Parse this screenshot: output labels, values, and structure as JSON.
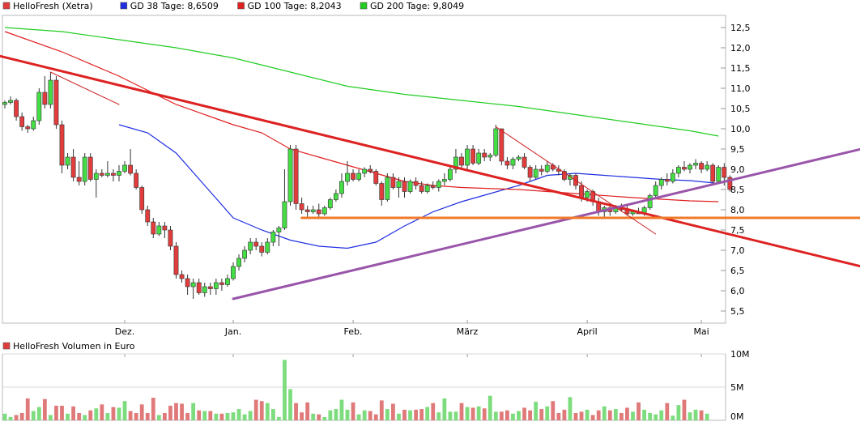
{
  "chart_data": [
    {
      "type": "candlestick",
      "legend": [
        {
          "label": "HelloFresh (Xetra)",
          "color": "#e03c3c"
        },
        {
          "label": "GD 38 Tage: 8,6509",
          "color": "#1f2fe0"
        },
        {
          "label": "GD 100 Tage: 8,2043",
          "color": "#e02020"
        },
        {
          "label": "GD 200 Tage: 9,8049",
          "color": "#22cc22"
        }
      ],
      "ylim": [
        5.2,
        12.8
      ],
      "y_ticks": [
        "5,5",
        "6,0",
        "6,5",
        "7,0",
        "7,5",
        "8,0",
        "8,5",
        "9,0",
        "9,5",
        "10,0",
        "10,5",
        "11,0",
        "11,5",
        "12,0",
        "12,5"
      ],
      "x_ticks": [
        {
          "label": "Dez.",
          "index": 21
        },
        {
          "label": "Jan.",
          "index": 40
        },
        {
          "label": "Feb.",
          "index": 61
        },
        {
          "label": "März",
          "index": 81
        },
        {
          "label": "April",
          "index": 102
        },
        {
          "label": "Mai",
          "index": 122
        }
      ],
      "ohlc": [
        [
          10.6,
          10.7,
          10.5,
          10.65
        ],
        [
          10.65,
          10.8,
          10.6,
          10.7
        ],
        [
          10.7,
          10.75,
          10.2,
          10.3
        ],
        [
          10.3,
          10.4,
          9.95,
          10.05
        ],
        [
          10.05,
          10.1,
          9.9,
          10.0
        ],
        [
          10.0,
          10.3,
          9.95,
          10.2
        ],
        [
          10.2,
          11.0,
          10.1,
          10.9
        ],
        [
          10.9,
          11.3,
          10.5,
          10.6
        ],
        [
          10.6,
          11.4,
          10.5,
          11.2
        ],
        [
          11.2,
          11.3,
          10.0,
          10.1
        ],
        [
          10.1,
          10.2,
          8.9,
          9.1
        ],
        [
          9.1,
          9.4,
          9.0,
          9.3
        ],
        [
          9.3,
          9.5,
          8.7,
          8.8
        ],
        [
          8.8,
          9.2,
          8.6,
          8.7
        ],
        [
          8.7,
          9.4,
          8.6,
          9.3
        ],
        [
          9.3,
          9.4,
          8.7,
          8.75
        ],
        [
          8.75,
          9.0,
          8.3,
          8.9
        ],
        [
          8.9,
          9.0,
          8.8,
          8.85
        ],
        [
          8.85,
          9.2,
          8.8,
          8.9
        ],
        [
          8.9,
          9.0,
          8.7,
          8.85
        ],
        [
          8.85,
          9.1,
          8.7,
          8.95
        ],
        [
          8.95,
          9.2,
          8.9,
          9.1
        ],
        [
          9.1,
          9.5,
          8.85,
          8.9
        ],
        [
          8.9,
          9.0,
          8.5,
          8.55
        ],
        [
          8.55,
          8.6,
          7.9,
          8.0
        ],
        [
          8.0,
          8.1,
          7.6,
          7.7
        ],
        [
          7.7,
          7.8,
          7.3,
          7.4
        ],
        [
          7.4,
          7.7,
          7.35,
          7.6
        ],
        [
          7.6,
          7.7,
          7.3,
          7.5
        ],
        [
          7.5,
          7.6,
          7.0,
          7.1
        ],
        [
          7.1,
          7.2,
          6.3,
          6.4
        ],
        [
          6.4,
          6.5,
          6.2,
          6.3
        ],
        [
          6.3,
          6.4,
          5.9,
          6.1
        ],
        [
          6.1,
          6.3,
          5.8,
          6.2
        ],
        [
          6.2,
          6.3,
          5.9,
          5.95
        ],
        [
          5.95,
          6.2,
          5.85,
          6.1
        ],
        [
          6.1,
          6.2,
          5.9,
          6.05
        ],
        [
          6.05,
          6.3,
          5.9,
          6.2
        ],
        [
          6.2,
          6.3,
          6.0,
          6.15
        ],
        [
          6.15,
          6.4,
          6.1,
          6.3
        ],
        [
          6.3,
          6.7,
          6.25,
          6.6
        ],
        [
          6.6,
          6.9,
          6.5,
          6.8
        ],
        [
          6.8,
          7.1,
          6.7,
          7.0
        ],
        [
          7.0,
          7.3,
          6.9,
          7.2
        ],
        [
          7.2,
          7.3,
          7.0,
          7.1
        ],
        [
          7.1,
          7.2,
          6.85,
          6.95
        ],
        [
          6.95,
          7.3,
          6.9,
          7.2
        ],
        [
          7.2,
          7.5,
          7.1,
          7.45
        ],
        [
          7.45,
          7.6,
          7.1,
          7.55
        ],
        [
          7.55,
          9.0,
          7.5,
          8.2
        ],
        [
          8.2,
          9.6,
          8.1,
          9.5
        ],
        [
          9.5,
          9.6,
          8.0,
          8.15
        ],
        [
          8.15,
          8.3,
          7.9,
          8.0
        ],
        [
          8.0,
          8.1,
          7.8,
          7.95
        ],
        [
          7.95,
          8.1,
          7.9,
          8.0
        ],
        [
          8.0,
          8.15,
          7.8,
          7.9
        ],
        [
          7.9,
          8.1,
          7.85,
          8.05
        ],
        [
          8.05,
          8.3,
          8.0,
          8.25
        ],
        [
          8.25,
          8.5,
          8.2,
          8.4
        ],
        [
          8.4,
          8.9,
          8.3,
          8.7
        ],
        [
          8.7,
          9.2,
          8.6,
          8.9
        ],
        [
          8.9,
          9.0,
          8.7,
          8.75
        ],
        [
          8.75,
          9.0,
          8.7,
          8.9
        ],
        [
          8.9,
          9.05,
          8.8,
          9.0
        ],
        [
          9.0,
          9.1,
          8.9,
          8.95
        ],
        [
          8.95,
          9.0,
          8.6,
          8.65
        ],
        [
          8.65,
          8.7,
          8.1,
          8.25
        ],
        [
          8.25,
          8.9,
          8.2,
          8.8
        ],
        [
          8.8,
          8.9,
          8.5,
          8.55
        ],
        [
          8.55,
          8.8,
          8.3,
          8.7
        ],
        [
          8.7,
          8.8,
          8.3,
          8.45
        ],
        [
          8.45,
          8.75,
          8.4,
          8.7
        ],
        [
          8.7,
          8.8,
          8.5,
          8.6
        ],
        [
          8.6,
          8.7,
          8.4,
          8.45
        ],
        [
          8.45,
          8.65,
          8.4,
          8.6
        ],
        [
          8.6,
          8.7,
          8.5,
          8.55
        ],
        [
          8.55,
          8.75,
          8.45,
          8.7
        ],
        [
          8.7,
          8.9,
          8.6,
          8.75
        ],
        [
          8.75,
          9.1,
          8.7,
          9.0
        ],
        [
          9.0,
          9.5,
          8.9,
          9.3
        ],
        [
          9.3,
          9.4,
          9.0,
          9.1
        ],
        [
          9.1,
          9.6,
          9.0,
          9.5
        ],
        [
          9.5,
          9.6,
          9.1,
          9.15
        ],
        [
          9.15,
          9.5,
          9.1,
          9.4
        ],
        [
          9.4,
          9.5,
          9.2,
          9.3
        ],
        [
          9.3,
          9.4,
          9.2,
          9.35
        ],
        [
          9.35,
          10.1,
          9.3,
          10.0
        ],
        [
          10.0,
          10.0,
          9.1,
          9.2
        ],
        [
          9.2,
          9.3,
          9.0,
          9.1
        ],
        [
          9.1,
          9.3,
          9.0,
          9.25
        ],
        [
          9.25,
          9.35,
          9.2,
          9.3
        ],
        [
          9.3,
          9.4,
          9.0,
          9.05
        ],
        [
          9.05,
          9.1,
          8.7,
          8.8
        ],
        [
          8.8,
          9.1,
          8.75,
          9.0
        ],
        [
          9.0,
          9.1,
          8.85,
          8.95
        ],
        [
          8.95,
          9.2,
          8.9,
          9.1
        ],
        [
          9.1,
          9.15,
          8.95,
          9.0
        ],
        [
          9.0,
          9.1,
          8.85,
          8.95
        ],
        [
          8.95,
          9.0,
          8.7,
          8.75
        ],
        [
          8.75,
          8.9,
          8.6,
          8.85
        ],
        [
          8.85,
          8.9,
          8.5,
          8.6
        ],
        [
          8.6,
          8.7,
          8.2,
          8.3
        ],
        [
          8.3,
          8.5,
          8.2,
          8.45
        ],
        [
          8.45,
          8.5,
          8.1,
          8.2
        ],
        [
          8.2,
          8.3,
          7.85,
          7.95
        ],
        [
          7.95,
          8.1,
          7.8,
          8.05
        ],
        [
          8.05,
          8.15,
          7.85,
          7.95
        ],
        [
          7.95,
          8.1,
          7.9,
          8.05
        ],
        [
          8.05,
          8.15,
          7.95,
          8.0
        ],
        [
          8.0,
          8.1,
          7.85,
          7.9
        ],
        [
          7.9,
          8.0,
          7.85,
          7.95
        ],
        [
          7.95,
          8.05,
          7.9,
          7.9
        ],
        [
          7.9,
          8.1,
          7.85,
          8.05
        ],
        [
          8.05,
          8.4,
          8.0,
          8.35
        ],
        [
          8.35,
          8.7,
          8.3,
          8.6
        ],
        [
          8.6,
          8.8,
          8.5,
          8.75
        ],
        [
          8.75,
          8.9,
          8.6,
          8.7
        ],
        [
          8.7,
          9.0,
          8.65,
          8.9
        ],
        [
          8.9,
          9.1,
          8.8,
          9.05
        ],
        [
          9.05,
          9.2,
          8.95,
          9.0
        ],
        [
          9.0,
          9.15,
          8.9,
          9.1
        ],
        [
          9.1,
          9.25,
          9.0,
          9.15
        ],
        [
          9.15,
          9.2,
          8.9,
          9.0
        ],
        [
          9.0,
          9.2,
          8.95,
          9.1
        ],
        [
          9.1,
          9.15,
          8.6,
          8.7
        ],
        [
          8.7,
          9.1,
          8.65,
          9.05
        ],
        [
          9.05,
          9.15,
          8.6,
          8.8
        ],
        [
          8.8,
          8.85,
          8.45,
          8.5
        ]
      ],
      "ma_lines": [
        {
          "name": "GD 38",
          "color": "#1f2fe0",
          "points": [
            [
              20,
              10.1
            ],
            [
              25,
              9.9
            ],
            [
              30,
              9.4
            ],
            [
              35,
              8.6
            ],
            [
              40,
              7.8
            ],
            [
              45,
              7.5
            ],
            [
              50,
              7.25
            ],
            [
              55,
              7.1
            ],
            [
              60,
              7.05
            ],
            [
              65,
              7.2
            ],
            [
              70,
              7.6
            ],
            [
              75,
              7.95
            ],
            [
              80,
              8.2
            ],
            [
              85,
              8.4
            ],
            [
              90,
              8.6
            ],
            [
              95,
              8.85
            ],
            [
              100,
              8.9
            ],
            [
              105,
              8.85
            ],
            [
              110,
              8.8
            ],
            [
              115,
              8.75
            ],
            [
              120,
              8.72
            ],
            [
              125,
              8.65
            ]
          ]
        },
        {
          "name": "GD 100",
          "color": "#e02020",
          "points": [
            [
              0,
              12.4
            ],
            [
              10,
              11.9
            ],
            [
              20,
              11.3
            ],
            [
              30,
              10.6
            ],
            [
              40,
              10.1
            ],
            [
              45,
              9.9
            ],
            [
              50,
              9.5
            ],
            [
              55,
              9.3
            ],
            [
              60,
              9.1
            ],
            [
              65,
              8.9
            ],
            [
              70,
              8.7
            ],
            [
              75,
              8.6
            ],
            [
              80,
              8.55
            ],
            [
              90,
              8.5
            ],
            [
              100,
              8.4
            ],
            [
              110,
              8.3
            ],
            [
              120,
              8.22
            ],
            [
              125,
              8.2
            ]
          ]
        },
        {
          "name": "GD 200",
          "color": "#22cc22",
          "points": [
            [
              0,
              12.5
            ],
            [
              10,
              12.4
            ],
            [
              20,
              12.2
            ],
            [
              30,
              12.0
            ],
            [
              40,
              11.75
            ],
            [
              50,
              11.4
            ],
            [
              60,
              11.05
            ],
            [
              70,
              10.85
            ],
            [
              80,
              10.7
            ],
            [
              90,
              10.55
            ],
            [
              100,
              10.35
            ],
            [
              110,
              10.15
            ],
            [
              120,
              9.95
            ],
            [
              125,
              9.82
            ]
          ]
        }
      ],
      "trendlines": [
        {
          "color": "#dd2222",
          "width": 3,
          "from": [
            -1,
            11.8
          ],
          "to": [
            150,
            6.6
          ]
        },
        {
          "color": "#9955aa",
          "width": 3,
          "from": [
            40,
            5.8
          ],
          "to": [
            150,
            9.5
          ]
        },
        {
          "color": "#f07a2a",
          "width": 3,
          "from": [
            52,
            7.8
          ],
          "to": [
            150,
            7.8
          ]
        },
        {
          "color": "#cc2222",
          "width": 1,
          "from": [
            8,
            11.4
          ],
          "to": [
            20,
            10.6
          ]
        },
        {
          "color": "#cc2222",
          "width": 1,
          "from": [
            86,
            10.05
          ],
          "to": [
            114,
            7.4
          ]
        }
      ]
    },
    {
      "type": "bar",
      "legend": [
        {
          "label": "HelloFresh Volumen in Euro",
          "color": "#e03c3c"
        }
      ],
      "ylim": [
        0,
        10
      ],
      "y_ticks": [
        "0M",
        "5M",
        "10M"
      ],
      "volumes": [
        1.0,
        0.5,
        0.8,
        1.1,
        3.3,
        1.4,
        2.0,
        3.2,
        0.8,
        2.2,
        2.2,
        1.0,
        2.1,
        1.1,
        0.8,
        1.5,
        1.8,
        2.4,
        1.1,
        2.0,
        1.9,
        2.9,
        1.4,
        1.1,
        2.4,
        1.1,
        3.4,
        0.8,
        1.1,
        2.2,
        2.6,
        2.5,
        1.1,
        2.6,
        1.5,
        1.4,
        1.4,
        1.0,
        1.0,
        1.1,
        1.2,
        1.7,
        0.9,
        1.4,
        3.1,
        2.9,
        2.6,
        1.7,
        0.5,
        9.1,
        4.7,
        2.6,
        1.2,
        2.7,
        1.0,
        0.9,
        0.5,
        1.5,
        1.7,
        3.1,
        1.6,
        2.7,
        0.9,
        1.5,
        1.4,
        0.9,
        3.0,
        1.7,
        2.5,
        1.0,
        1.6,
        1.5,
        1.6,
        1.7,
        2.0,
        2.6,
        1.2,
        3.3,
        1.3,
        1.3,
        2.6,
        2.0,
        1.9,
        2.1,
        1.8,
        3.7,
        1.3,
        1.3,
        1.5,
        1.0,
        1.4,
        1.9,
        1.5,
        2.8,
        1.7,
        2.1,
        2.9,
        1.1,
        1.6,
        3.5,
        1.1,
        1.3,
        1.6,
        0.8,
        1.5,
        2.1,
        1.5,
        1.7,
        1.1,
        1.9,
        1.3,
        2.7,
        1.6,
        1.1,
        0.9,
        1.5,
        2.6,
        0.7,
        2.3,
        3.1,
        1.2,
        1.6,
        1.5,
        1.0
      ]
    }
  ]
}
